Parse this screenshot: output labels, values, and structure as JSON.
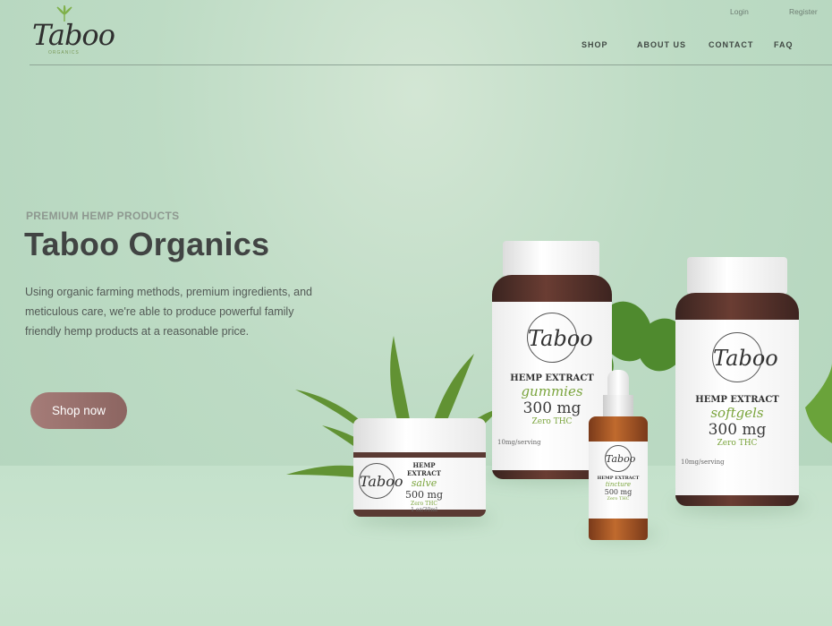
{
  "brand": {
    "logo_text": "Taboo",
    "logo_sub": "ORGANICS"
  },
  "auth": {
    "login": "Login",
    "register": "Register"
  },
  "nav": {
    "shop": "SHOP",
    "about": "ABOUT US",
    "contact": "CONTACT",
    "faq": "FAQ"
  },
  "hero": {
    "eyebrow": "PREMIUM HEMP PRODUCTS",
    "title": "Taboo Organics",
    "description": "Using organic farming methods, premium ingredients, and meticulous care, we're able to produce powerful family friendly hemp products at a reasonable price.",
    "cta": "Shop now"
  },
  "products": {
    "gummies": {
      "logo": "Taboo",
      "type": "HEMP EXTRACT",
      "name": "gummies",
      "strength": "300 mg",
      "thc": "Zero THC",
      "serving": "10mg/serving"
    },
    "softgels": {
      "logo": "Taboo",
      "type": "HEMP EXTRACT",
      "name": "softgels",
      "strength": "300 mg",
      "thc": "Zero THC",
      "serving": "10mg/serving"
    },
    "salve": {
      "logo": "Taboo",
      "type": "HEMP EXTRACT",
      "name": "salve",
      "strength": "500 mg",
      "thc": "Zero THC",
      "serving": "1 oz/30ml"
    },
    "tincture": {
      "logo": "Taboo",
      "type": "HEMP EXTRACT",
      "name": "tincture",
      "strength": "500 mg",
      "thc": "Zero THC"
    }
  },
  "colors": {
    "background": "#bddbc4",
    "cta": "#9a726e",
    "text_dark": "#414443",
    "accent_green": "#7aa43c"
  }
}
